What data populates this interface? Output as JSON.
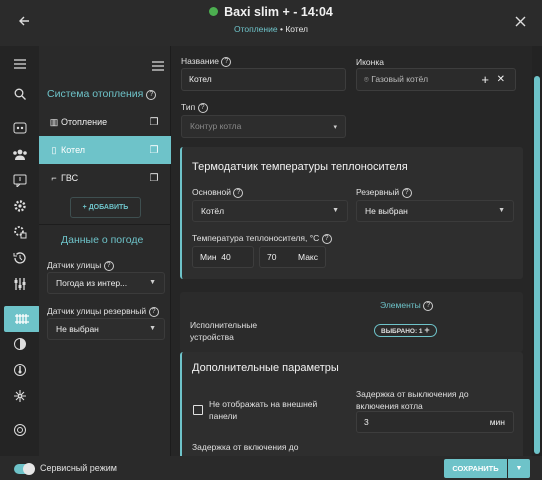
{
  "header": {
    "title": "Baxi slim + - 14:04",
    "crumb_parent": "Отопление",
    "crumb_sep": "•",
    "crumb_current": "Котел",
    "back_icon": "arrow-left-icon",
    "close_icon": "close-icon"
  },
  "rail": {
    "menu_icon": "☰",
    "search_icon": "🔍",
    "items": [
      "⚙",
      "👥",
      "💬",
      "⚙",
      "⚙",
      "⚙",
      "⚙",
      "♨",
      "◐",
      "🌡",
      "❄",
      "⚙"
    ]
  },
  "system": {
    "title": "Система отопления",
    "items": [
      {
        "label": "Отопление",
        "selected": false
      },
      {
        "label": "Котел",
        "selected": true
      },
      {
        "label": "ГВС",
        "selected": false
      }
    ],
    "add_label": "ДОБАВИТЬ",
    "weather_title": "Данные о погоде",
    "street_sensor_label": "Датчик улицы",
    "street_sensor_value": "Погода из интер...",
    "street_sensor_backup_label": "Датчик улицы резервный",
    "street_sensor_backup_value": "Не выбран"
  },
  "main": {
    "name_label": "Название",
    "name_value": "Котел",
    "icon_label": "Иконка",
    "icon_value": "Газовый котёл",
    "type_label": "Тип",
    "type_placeholder": "Контур котла",
    "sensor_card": {
      "title": "Термодатчик температуры теплоносителя",
      "primary_label": "Основной",
      "primary_value": "Котёл",
      "backup_label": "Резервный",
      "backup_value": "Не выбран",
      "temp_label": "Температура теплоносителя, °C",
      "min_label": "Мин",
      "min_value": "40",
      "max_value": "70",
      "max_label": "Макс"
    },
    "elements_label": "Элементы",
    "actuators_label_1": "Исполнительные",
    "actuators_label_2": "устройства",
    "selected_pill": "ВЫБРАНО: 1",
    "extra_card": {
      "title": "Дополнительные параметры",
      "hide_label_1": "Не отображать на внешней",
      "hide_label_2": "панели",
      "off_delay_label_1": "Задержка от выключения до",
      "off_delay_label_2": "включения котла",
      "off_delay_value": "3",
      "off_delay_unit": "мин",
      "on_delay_label": "Задержка от включения до"
    }
  },
  "footer": {
    "service_mode_label": "Сервисный режим",
    "save_label": "СОХРАНИТЬ"
  },
  "colors": {
    "accent": "#6ec3c9",
    "status_online": "#4caf50",
    "background": "#262626"
  }
}
